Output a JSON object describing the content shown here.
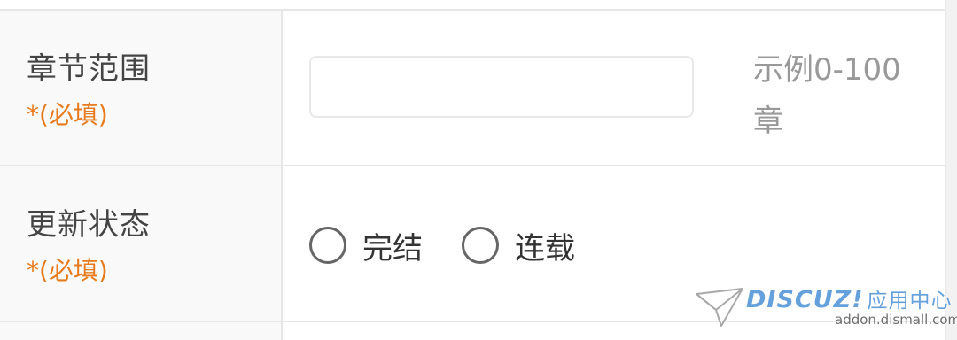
{
  "form": {
    "chapter_range": {
      "label": "章节范围",
      "required": "*(必填)",
      "input_value": "",
      "input_placeholder": "",
      "hint": "示例0-100章"
    },
    "update_status": {
      "label": "更新状态",
      "required": "*(必填)",
      "options": [
        {
          "label": "完结",
          "selected": false
        },
        {
          "label": "连载",
          "selected": false
        }
      ]
    }
  },
  "watermark": {
    "brand": "DISCUZ!",
    "brand_cn": "应用中心",
    "url": "addon.dismall.com",
    "icon": "paper-plane-icon"
  },
  "colors": {
    "required_accent": "#e77a1c",
    "label_text": "#444444",
    "hint_text": "#999999",
    "border": "#e6e6e6",
    "label_bg": "#f9f9f9",
    "watermark_blue": "#4a90d6"
  }
}
